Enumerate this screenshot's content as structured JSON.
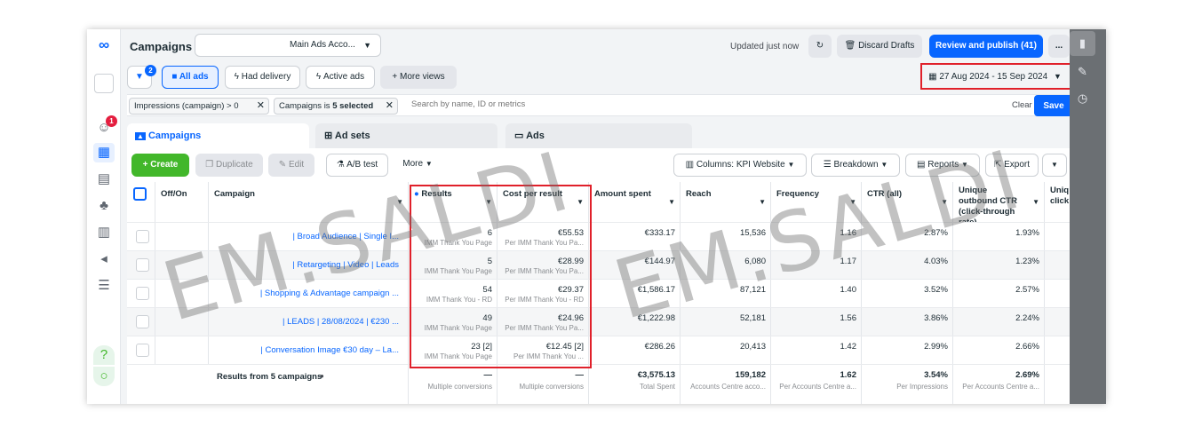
{
  "topbar": {
    "title": "Campaigns",
    "account": "Main Ads Acco...",
    "updated": "Updated just now",
    "discard": "Discard Drafts",
    "review": "Review and publish (41)",
    "more": "..."
  },
  "viewbar": {
    "filter_badge": "2",
    "all_ads": "All ads",
    "had_delivery": "Had delivery",
    "active_ads": "Active ads",
    "more_views": "More views",
    "date_range": "27 Aug 2024 - 15 Sep 2024"
  },
  "filterbar": {
    "chip1": "Impressions (campaign) > 0",
    "chip2_pre": "Campaigns is ",
    "chip2_bold": "5 selected",
    "search_placeholder": "Search by name, ID or metrics",
    "clear": "Clear",
    "save": "Save"
  },
  "tabs": {
    "campaigns": "Campaigns",
    "adsets": "Ad sets",
    "ads": "Ads"
  },
  "toolbar": {
    "create": "Create",
    "duplicate": "Duplicate",
    "edit": "Edit",
    "ab_test": "A/B test",
    "more": "More",
    "columns": "Columns: KPI Website",
    "breakdown": "Breakdown",
    "reports": "Reports",
    "export": "Export"
  },
  "table": {
    "headers": {
      "offon": "Off/On",
      "campaign": "Campaign",
      "results": "Results",
      "cpr": "Cost per result",
      "amount": "Amount spent",
      "reach": "Reach",
      "frequency": "Frequency",
      "ctr": "CTR (all)",
      "unique": "Unique outbound CTR (click-through rate)",
      "uniq2": "Uniq click"
    },
    "rows": [
      {
        "campaign": "| Broad Audience | Single I...",
        "results": "6",
        "results_sub": "IMM Thank You Page",
        "cpr": "€55.53",
        "cpr_sub": "Per IMM Thank You Pa...",
        "amount": "€333.17",
        "reach": "15,536",
        "frequency": "1.16",
        "ctr": "2.87%",
        "unique": "1.93%"
      },
      {
        "campaign": "| Retargeting | Video | Leads",
        "results": "5",
        "results_sub": "IMM Thank You Page",
        "cpr": "€28.99",
        "cpr_sub": "Per IMM Thank You Pa...",
        "amount": "€144.97",
        "reach": "6,080",
        "frequency": "1.17",
        "ctr": "4.03%",
        "unique": "1.23%"
      },
      {
        "campaign": "| Shopping & Advantage campaign ...",
        "results": "54",
        "results_sub": "IMM Thank You - RD",
        "cpr": "€29.37",
        "cpr_sub": "Per IMM Thank You - RD",
        "amount": "€1,586.17",
        "reach": "87,121",
        "frequency": "1.40",
        "ctr": "3.52%",
        "unique": "2.57%"
      },
      {
        "campaign": "| LEADS | 28/08/2024 | €230 ...",
        "results": "49",
        "results_sub": "IMM Thank You Page",
        "cpr": "€24.96",
        "cpr_sub": "Per IMM Thank You Pa...",
        "amount": "€1,222.98",
        "reach": "52,181",
        "frequency": "1.56",
        "ctr": "3.86%",
        "unique": "2.24%"
      },
      {
        "campaign": "| Conversation Image €30 day – La...",
        "results": "23 [2]",
        "results_sub": "IMM Thank You Page",
        "cpr": "€12.45 [2]",
        "cpr_sub": "Per IMM Thank You ...",
        "amount": "€286.26",
        "reach": "20,413",
        "frequency": "1.42",
        "ctr": "2.99%",
        "unique": "2.66%"
      }
    ],
    "totals": {
      "label": "Results from 5 campaigns",
      "results": "—",
      "results_sub": "Multiple conversions",
      "cpr": "—",
      "cpr_sub": "Multiple conversions",
      "amount": "€3,575.13",
      "amount_sub": "Total Spent",
      "reach": "159,182",
      "reach_sub": "Accounts Centre acco...",
      "frequency": "1.62",
      "frequency_sub": "Per Accounts Centre a...",
      "ctr": "3.54%",
      "ctr_sub": "Per Impressions",
      "unique": "2.69%",
      "unique_sub": "Per Accounts Centre a..."
    }
  },
  "leftnav": {
    "notif_badge": "1"
  },
  "watermark": "EM.SALDI",
  "colors": {
    "accent": "#0866ff",
    "create": "#42b72a",
    "highlight": "#e0202a"
  }
}
